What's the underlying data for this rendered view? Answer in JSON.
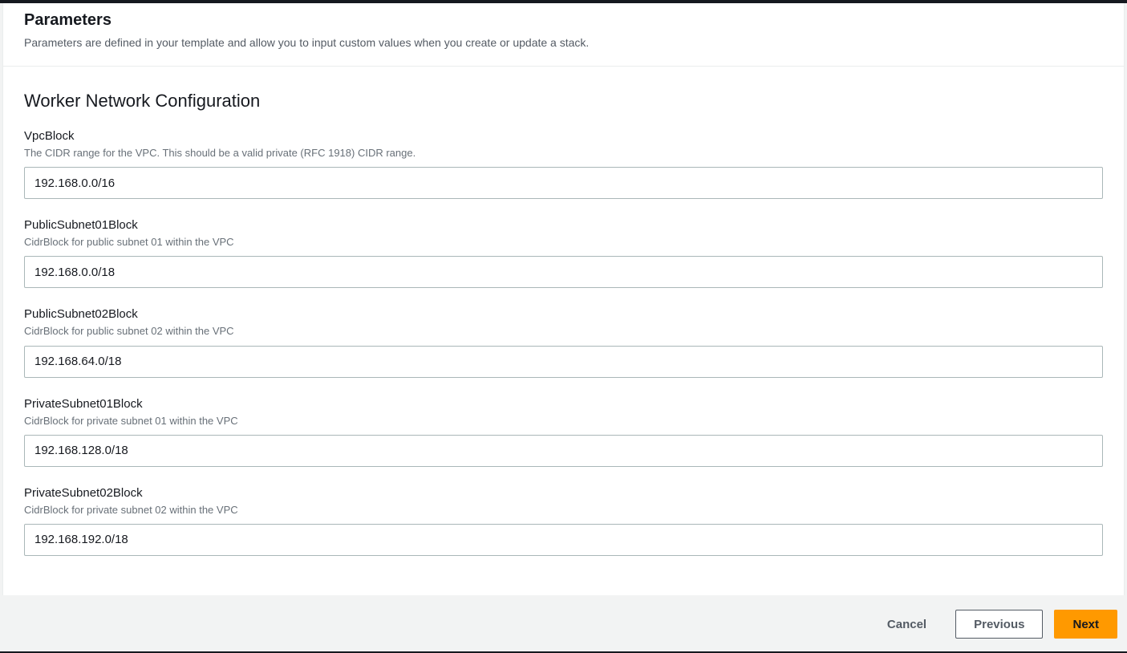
{
  "header": {
    "title": "Parameters",
    "description": "Parameters are defined in your template and allow you to input custom values when you create or update a stack."
  },
  "section": {
    "title": "Worker Network Configuration",
    "fields": [
      {
        "label": "VpcBlock",
        "description": "The CIDR range for the VPC. This should be a valid private (RFC 1918) CIDR range.",
        "value": "192.168.0.0/16"
      },
      {
        "label": "PublicSubnet01Block",
        "description": "CidrBlock for public subnet 01 within the VPC",
        "value": "192.168.0.0/18"
      },
      {
        "label": "PublicSubnet02Block",
        "description": "CidrBlock for public subnet 02 within the VPC",
        "value": "192.168.64.0/18"
      },
      {
        "label": "PrivateSubnet01Block",
        "description": "CidrBlock for private subnet 01 within the VPC",
        "value": "192.168.128.0/18"
      },
      {
        "label": "PrivateSubnet02Block",
        "description": "CidrBlock for private subnet 02 within the VPC",
        "value": "192.168.192.0/18"
      }
    ]
  },
  "footer": {
    "cancel": "Cancel",
    "previous": "Previous",
    "next": "Next"
  }
}
